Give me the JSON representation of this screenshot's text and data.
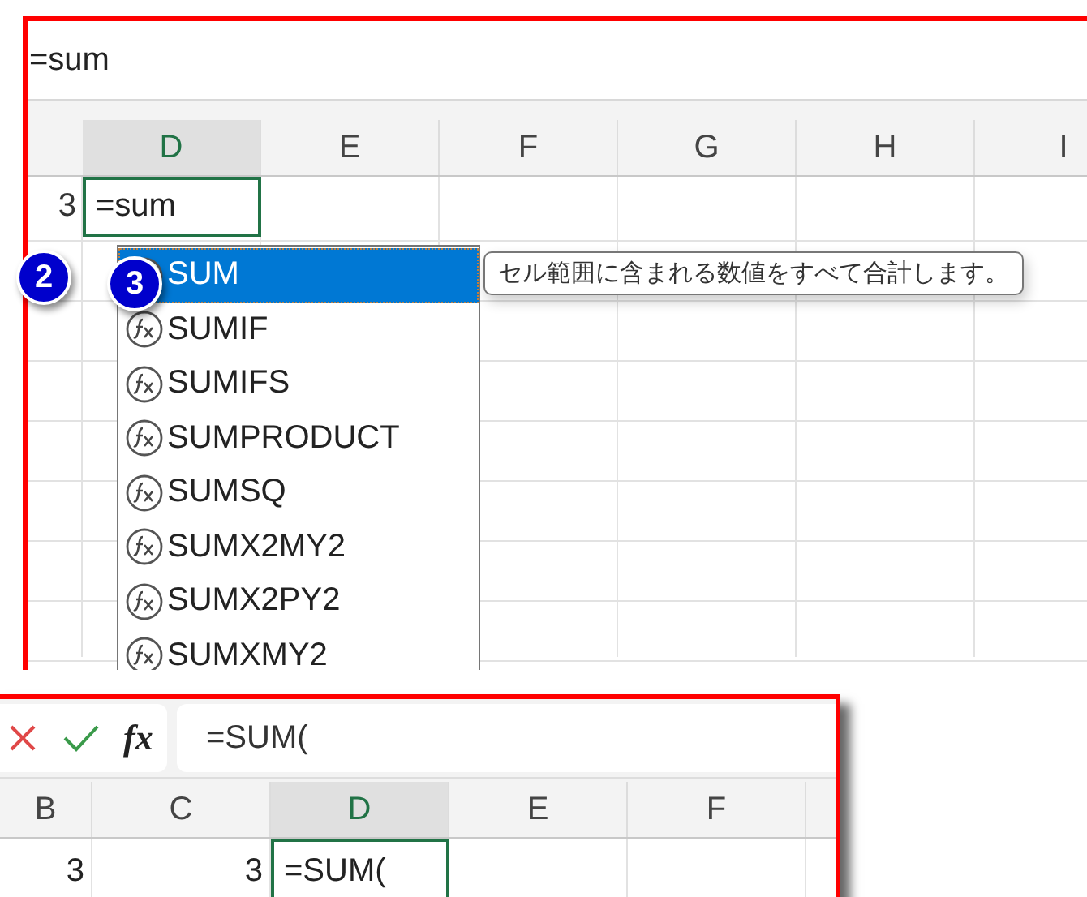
{
  "top_panel": {
    "formula_bar": {
      "value": "=sum"
    },
    "columns": [
      {
        "label": "D",
        "selected": true
      },
      {
        "label": "E",
        "selected": false
      },
      {
        "label": "F",
        "selected": false
      },
      {
        "label": "G",
        "selected": false
      },
      {
        "label": "H",
        "selected": false
      },
      {
        "label": "I",
        "selected": false
      }
    ],
    "row": {
      "number": "3",
      "cells": [
        {
          "value": "=sum",
          "selected": true
        }
      ]
    },
    "autocomplete": {
      "items": [
        {
          "label": "SUM",
          "selected": true
        },
        {
          "label": "SUMIF",
          "selected": false
        },
        {
          "label": "SUMIFS",
          "selected": false
        },
        {
          "label": "SUMPRODUCT",
          "selected": false
        },
        {
          "label": "SUMSQ",
          "selected": false
        },
        {
          "label": "SUMX2MY2",
          "selected": false
        },
        {
          "label": "SUMX2PY2",
          "selected": false
        },
        {
          "label": "SUMXMY2",
          "selected": false
        }
      ]
    },
    "tooltip": "セル範囲に含まれる数値をすべて合計します。"
  },
  "badges": [
    {
      "label": "2"
    },
    {
      "label": "3"
    }
  ],
  "bottom_panel": {
    "insert_function": "fx",
    "formula_bar": {
      "value": "=SUM("
    },
    "columns": [
      {
        "label": "B",
        "selected": false
      },
      {
        "label": "C",
        "selected": false
      },
      {
        "label": "D",
        "selected": true
      },
      {
        "label": "E",
        "selected": false
      },
      {
        "label": "F",
        "selected": false
      }
    ],
    "row": {
      "cells": [
        {
          "value": "3",
          "selected": false
        },
        {
          "value": "3",
          "selected": false
        },
        {
          "value": "=SUM(",
          "selected": true
        }
      ]
    }
  }
}
